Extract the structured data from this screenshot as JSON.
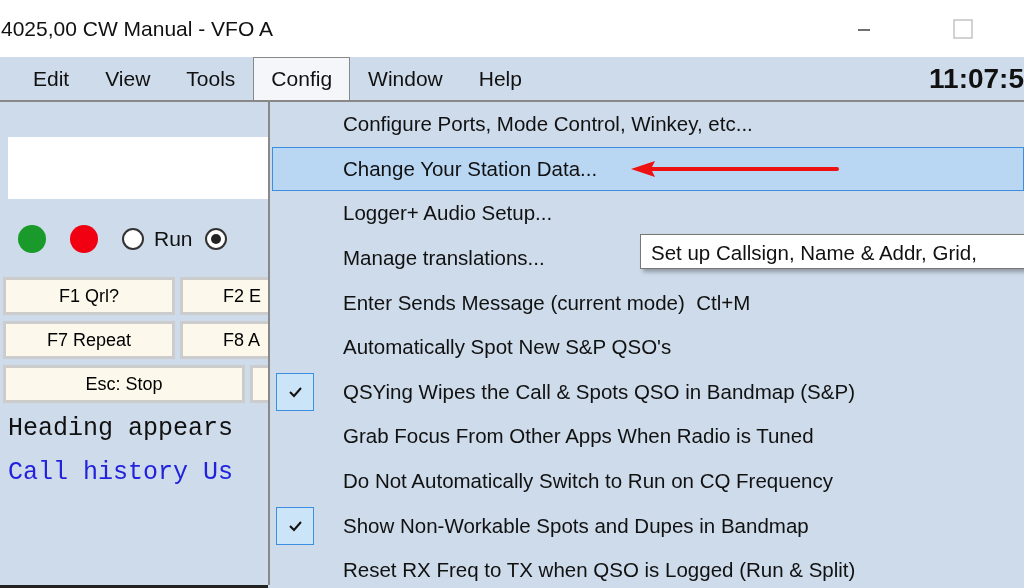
{
  "window": {
    "title": "4025,00 CW Manual - VFO A"
  },
  "menubar": [
    {
      "label": "Edit",
      "selected": false
    },
    {
      "label": "View",
      "selected": false
    },
    {
      "label": "Tools",
      "selected": false
    },
    {
      "label": "Config",
      "selected": true
    },
    {
      "label": "Window",
      "selected": false
    },
    {
      "label": "Help",
      "selected": false
    }
  ],
  "clock": "11:07:5",
  "status_dots": [
    {
      "color": "#1a9a2a"
    },
    {
      "color": "#f00010"
    }
  ],
  "mode_radios": [
    {
      "label": "Run",
      "selected": false
    },
    {
      "selected": true
    }
  ],
  "function_keys": [
    {
      "keys": [
        {
          "label": "F1 Qrl?"
        },
        {
          "label": "F2 E"
        }
      ]
    },
    {
      "keys": [
        {
          "label": "F7 Repeat"
        },
        {
          "label": "F8 A"
        }
      ]
    },
    {
      "keys": [
        {
          "label": "Esc: Stop"
        }
      ],
      "partly_hidden_button": true
    }
  ],
  "log_lines": [
    {
      "text": "Heading appears",
      "kind": "heading"
    },
    {
      "text": "Call history Us",
      "kind": "history"
    }
  ],
  "config_menu": [
    {
      "label": "Configure Ports, Mode Control, Winkey, etc...",
      "checked": false,
      "selected": false
    },
    {
      "label": "Change Your Station Data...",
      "checked": false,
      "selected": true
    },
    {
      "label": "Logger+ Audio Setup...",
      "checked": false,
      "selected": false
    },
    {
      "label": "Manage translations...",
      "checked": false,
      "selected": false
    },
    {
      "label": "Enter Sends Message (current mode)  Ctl+M",
      "checked": false,
      "selected": false
    },
    {
      "label": "Automatically Spot New S&P QSO's",
      "checked": false,
      "selected": false
    },
    {
      "label": "QSYing Wipes the Call & Spots QSO in Bandmap (S&P)",
      "checked": true,
      "selected": false
    },
    {
      "label": "Grab Focus From Other Apps When Radio is Tuned",
      "checked": false,
      "selected": false
    },
    {
      "label": "Do Not Automatically Switch to Run on CQ Frequency",
      "checked": false,
      "selected": false
    },
    {
      "label": "Show Non-Workable Spots and Dupes in Bandmap",
      "checked": true,
      "selected": false
    },
    {
      "label": "Reset RX Freq to TX when QSO is Logged (Run & Split)",
      "checked": false,
      "selected": false
    }
  ],
  "tooltip": "Set up Callsign, Name & Addr, Grid,"
}
